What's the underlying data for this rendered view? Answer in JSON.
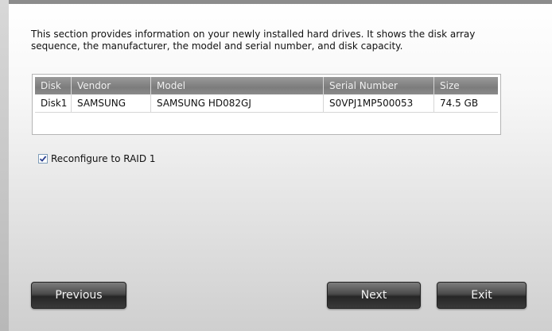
{
  "intro": {
    "line1": "This section provides information on your newly installed hard drives. It shows the disk array",
    "line2": "sequence, the manufacturer, the model and serial number, and disk capacity."
  },
  "table": {
    "headers": [
      "Disk",
      "Vendor",
      "Model",
      "Serial Number",
      "Size"
    ],
    "rows": [
      [
        "Disk1",
        "SAMSUNG",
        "SAMSUNG HD082GJ",
        "S0VPJ1MP500053",
        "74.5 GB"
      ]
    ]
  },
  "options": {
    "reconfigure_label": "Reconfigure to RAID 1",
    "reconfigure_checked": true
  },
  "buttons": {
    "previous": "Previous",
    "next": "Next",
    "exit": "Exit"
  },
  "colors": {
    "header_bg": "#8a8a8a",
    "button_bg": "#3a3a3a"
  }
}
